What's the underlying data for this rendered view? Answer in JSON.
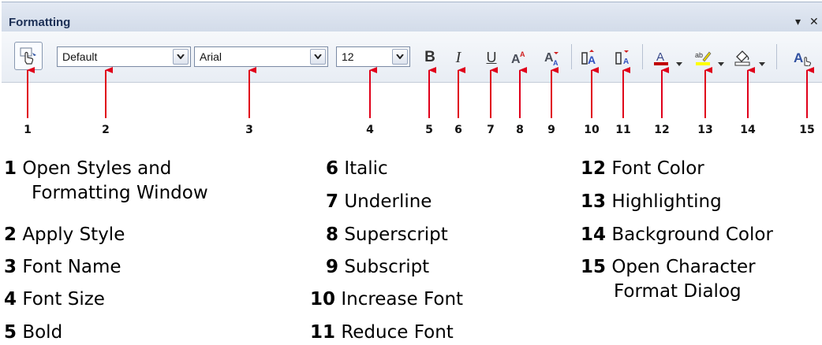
{
  "toolbar": {
    "title": "Formatting",
    "controls": [
      "▾",
      "✕"
    ],
    "style_value": "Default",
    "font_value": "Arial",
    "size_value": "12",
    "bold_glyph": "B",
    "italic_glyph": "I",
    "underline_glyph": "U"
  },
  "callout_numbers": [
    "1",
    "2",
    "3",
    "4",
    "5",
    "6",
    "7",
    "8",
    "9",
    "10",
    "11",
    "12",
    "13",
    "14",
    "15"
  ],
  "legend": {
    "col1": [
      {
        "num": "1",
        "text": "Open Styles and",
        "cont": "Formatting Window"
      },
      {
        "num": "2",
        "text": "Apply Style"
      },
      {
        "num": "3",
        "text": "Font Name"
      },
      {
        "num": "4",
        "text": "Font Size"
      },
      {
        "num": "5",
        "text": "Bold"
      }
    ],
    "col2": [
      {
        "num": "6",
        "text": "Italic"
      },
      {
        "num": "7",
        "text": "Underline"
      },
      {
        "num": "8",
        "text": "Superscript"
      },
      {
        "num": "9",
        "text": "Subscript"
      },
      {
        "num": "10",
        "text": "Increase Font"
      },
      {
        "num": "11",
        "text": "Reduce Font"
      }
    ],
    "col3": [
      {
        "num": "12",
        "text": "Font Color"
      },
      {
        "num": "13",
        "text": "Highlighting"
      },
      {
        "num": "14",
        "text": "Background Color"
      },
      {
        "num": "15",
        "text": "Open Character",
        "cont": "Format Dialog"
      }
    ]
  },
  "colors": {
    "arrow": "#e0001a",
    "font_color_bar": "#c00000",
    "highlight_bar": "#ffff00",
    "title_text": "#1c2f55"
  }
}
